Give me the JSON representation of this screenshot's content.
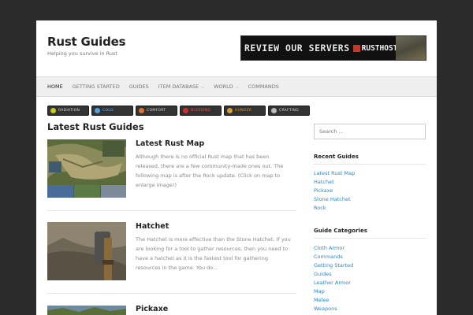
{
  "site": {
    "title": "Rust Guides",
    "description": "Helping you survive in Rust"
  },
  "banner": {
    "text": "REVIEW OUR SERVERS",
    "logo": "RUSTHOST"
  },
  "nav": {
    "items": [
      "HOME",
      "GETTING STARTED",
      "GUIDES",
      "ITEM DATABASE",
      "WORLD",
      "COMMANDS"
    ]
  },
  "topics": [
    {
      "label": "Radiation",
      "icon": "radiation-icon",
      "color": "#c8c81e"
    },
    {
      "label": "Cold",
      "icon": "snowflake-icon",
      "color": "#4aa3df"
    },
    {
      "label": "Comfort",
      "icon": "fire-icon",
      "color": "#e0712a"
    },
    {
      "label": "Bleeding",
      "icon": "blood-drop-icon",
      "color": "#d0302a"
    },
    {
      "label": "Hunger",
      "icon": "food-icon",
      "color": "#d79b3a"
    },
    {
      "label": "Crafting",
      "icon": "wrench-icon",
      "color": "#bbbbbb"
    }
  ],
  "main": {
    "section_title": "Latest Rust Guides",
    "posts": [
      {
        "title": "Latest Rust Map",
        "excerpt": "Although there is no official Rust map that has been released, there are a few community-made ones out. The following map is after the Rock update. (Click on map to enlarge image!)"
      },
      {
        "title": "Hatchet",
        "excerpt": "The Hatchet is more effective than the Stone Hatchet. If you are looking for a tool to gather resources, then you need to have a hatchet as it is the fastest tool for gathering resources in the game. You do..."
      },
      {
        "title": "Pickaxe",
        "excerpt": ""
      }
    ]
  },
  "sidebar": {
    "search_placeholder": "Search ...",
    "recent": {
      "title": "Recent Guides",
      "items": [
        "Latest Rust Map",
        "Hatchet",
        "Pickaxe",
        "Stone Hatchet",
        "Rock"
      ]
    },
    "categories": {
      "title": "Guide Categories",
      "items": [
        "Cloth Armor",
        "Commands",
        "Getting Started",
        "Guides",
        "Leather Armor",
        "Map",
        "Melee",
        "Weapons"
      ]
    }
  },
  "colors": {
    "link": "#2a88c8",
    "page_bg": "#2b2b2b"
  }
}
